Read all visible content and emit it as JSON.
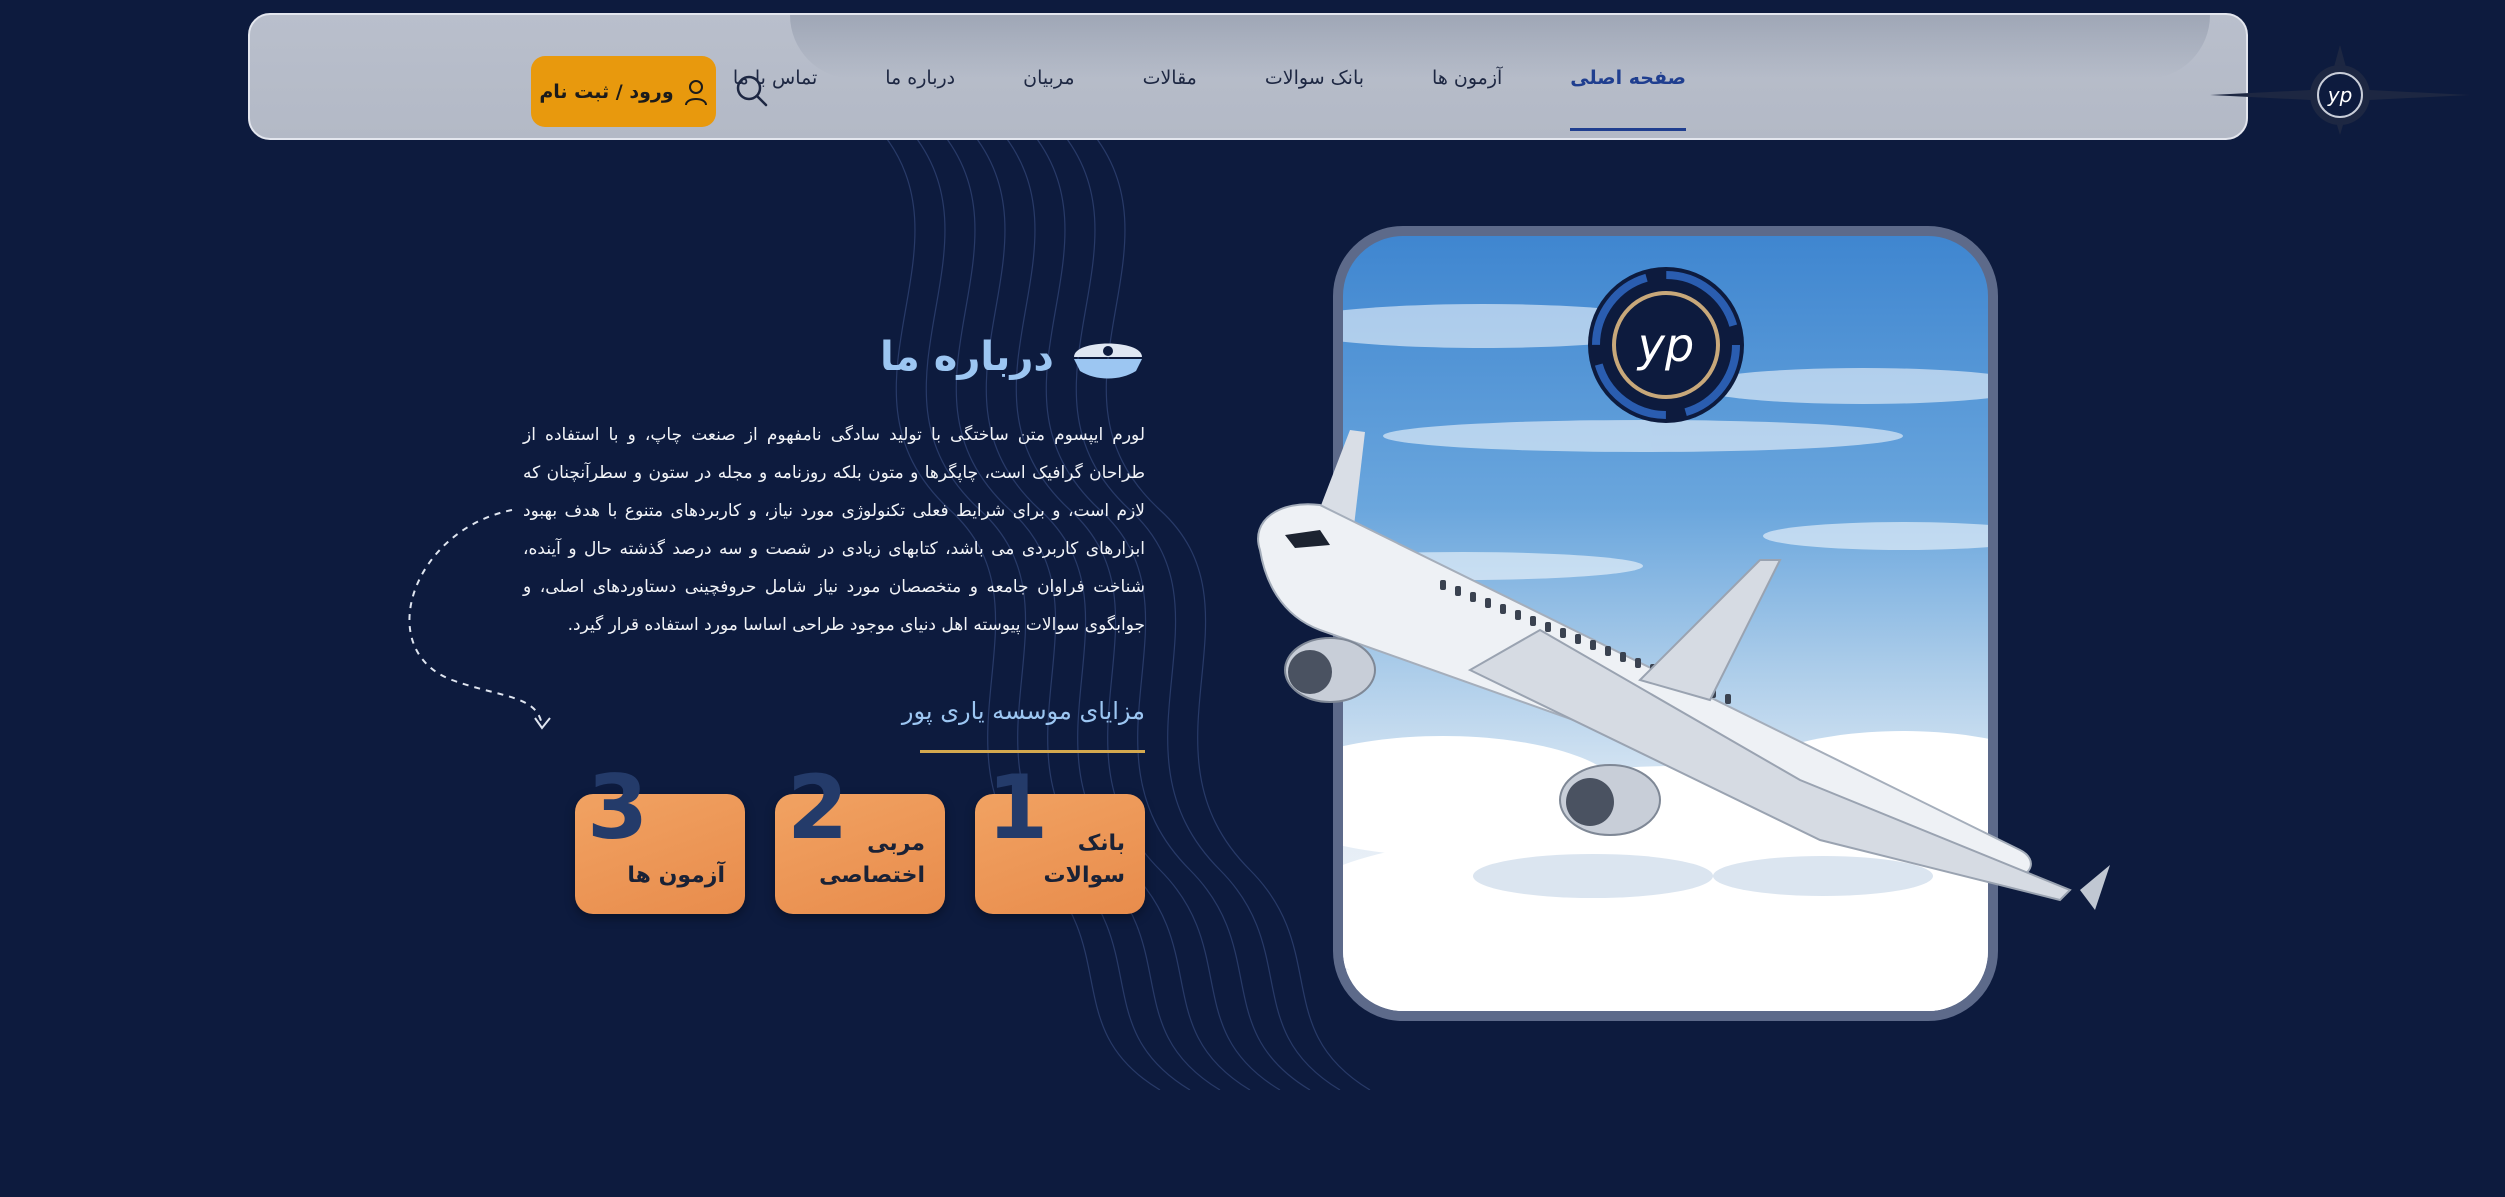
{
  "header": {
    "nav": [
      {
        "label": "صفحه اصلی",
        "active": true
      },
      {
        "label": "آزمون ها",
        "active": false
      },
      {
        "label": "بانک سوالات",
        "active": false
      },
      {
        "label": "مقالات",
        "active": false
      },
      {
        "label": "مربیان",
        "active": false
      },
      {
        "label": "درباره ما",
        "active": false
      },
      {
        "label": "تماس با ما",
        "active": false
      }
    ],
    "login_label": "ورود / ثبت نام",
    "logo_text": "yp",
    "icons": {
      "search": "search-icon",
      "user": "user-icon"
    }
  },
  "about": {
    "title": "درباره ما",
    "text": "لورم ایپسوم متن ساختگی با تولید سادگی نامفهوم از صنعت چاپ، و با استفاده از طراحان گرافیک است، چاپگرها و متون بلکه روزنامه و مجله در ستون و سطرآنچنان که لازم است، و برای شرایط فعلی تکنولوژی مورد نیاز، و کاربردهای متنوع با هدف بهبود ابزارهای کاربردی می باشد، کتابهای زیادی در شصت و سه درصد گذشته حال و آینده، شناخت فراوان جامعه و متخصصان مورد نیاز شامل حروفچینی دستاوردهای اصلی، و جوابگوی سوالات پیوسته اهل دنیای موجود طراحی اساسا مورد استفاده قرار گیرد.",
    "advantages_title": "مزایای موسسه یاری پور",
    "cards": [
      {
        "num": "1",
        "label": "بانک سوالات"
      },
      {
        "num": "2",
        "label": "مربی اختصاصی"
      },
      {
        "num": "3",
        "label": "آزمون ها"
      }
    ]
  },
  "hero": {
    "badge_text": "yp"
  },
  "colors": {
    "background": "#0d1b3e",
    "accent": "#e8990d",
    "card": "#f1a262",
    "title": "#9cc6f2",
    "nav_active": "#1f3e8f"
  }
}
